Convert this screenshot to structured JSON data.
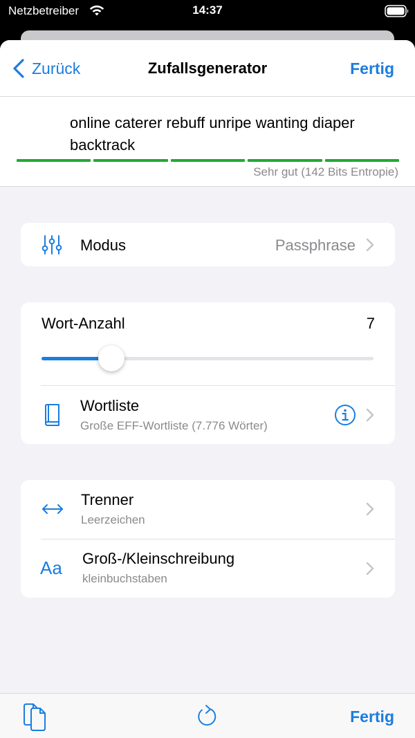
{
  "status_bar": {
    "carrier": "Netzbetreiber",
    "time": "14:37"
  },
  "nav": {
    "back_label": "Zurück",
    "title": "Zufallsgenerator",
    "done_label": "Fertig"
  },
  "generated": {
    "phrase": "online caterer rebuff unripe wanting diaper backtrack",
    "strength_label": "Sehr gut (142 Bits Entropie)",
    "strength_segments": 5
  },
  "mode_row": {
    "title": "Modus",
    "value": "Passphrase",
    "icon": "sliders-icon"
  },
  "word_count": {
    "label": "Wort-Anzahl",
    "value": "7",
    "slider_fraction": 0.21
  },
  "wordlist_row": {
    "title": "Wortliste",
    "subtitle": "Große EFF-Wortliste (7.776 Wörter)",
    "icon": "book-icon",
    "info_icon": "info-icon"
  },
  "separator_row": {
    "title": "Trenner",
    "subtitle": "Leerzeichen",
    "icon": "arrows-horizontal-icon"
  },
  "case_row": {
    "title": "Groß-/Kleinschreibung",
    "subtitle": "kleinbuchstaben",
    "icon_text": "Aa"
  },
  "toolbar": {
    "done_label": "Fertig",
    "copy_icon": "copy-icon",
    "refresh_icon": "refresh-icon"
  },
  "colors": {
    "accent": "#1a7de0",
    "strength": "#22a834",
    "background": "#f2f2f7"
  }
}
